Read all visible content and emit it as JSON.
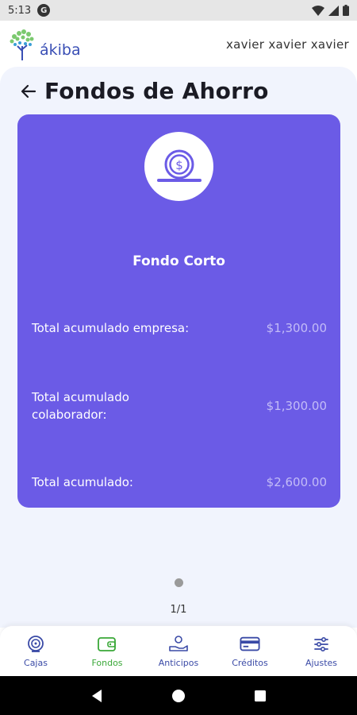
{
  "status_bar": {
    "time": "5:13",
    "notification_letter": "G"
  },
  "header": {
    "logo_text": "ákiba",
    "user_name": "xavier  xavier xavier"
  },
  "page": {
    "title": "Fondos de Ahorro"
  },
  "fund_card": {
    "name": "Fondo Corto",
    "rows": [
      {
        "label": "Total acumulado empresa:",
        "value": "$1,300.00"
      },
      {
        "label": "Total acumulado colaborador:",
        "value": "$1,300.00"
      },
      {
        "label": "Total acumulado:",
        "value": "$2,600.00"
      }
    ],
    "card_color": "#6b5be6"
  },
  "pagination": {
    "counter": "1/1"
  },
  "bottom_nav": {
    "items": [
      {
        "label": "Cajas",
        "icon": "safe-icon",
        "active": false
      },
      {
        "label": "Fondos",
        "icon": "wallet-icon",
        "active": true
      },
      {
        "label": "Anticipos",
        "icon": "hand-money-icon",
        "active": false
      },
      {
        "label": "Créditos",
        "icon": "credit-card-icon",
        "active": false
      },
      {
        "label": "Ajustes",
        "icon": "sliders-icon",
        "active": false
      }
    ],
    "active_color": "#3aa838",
    "inactive_color": "#3a4aa6"
  }
}
